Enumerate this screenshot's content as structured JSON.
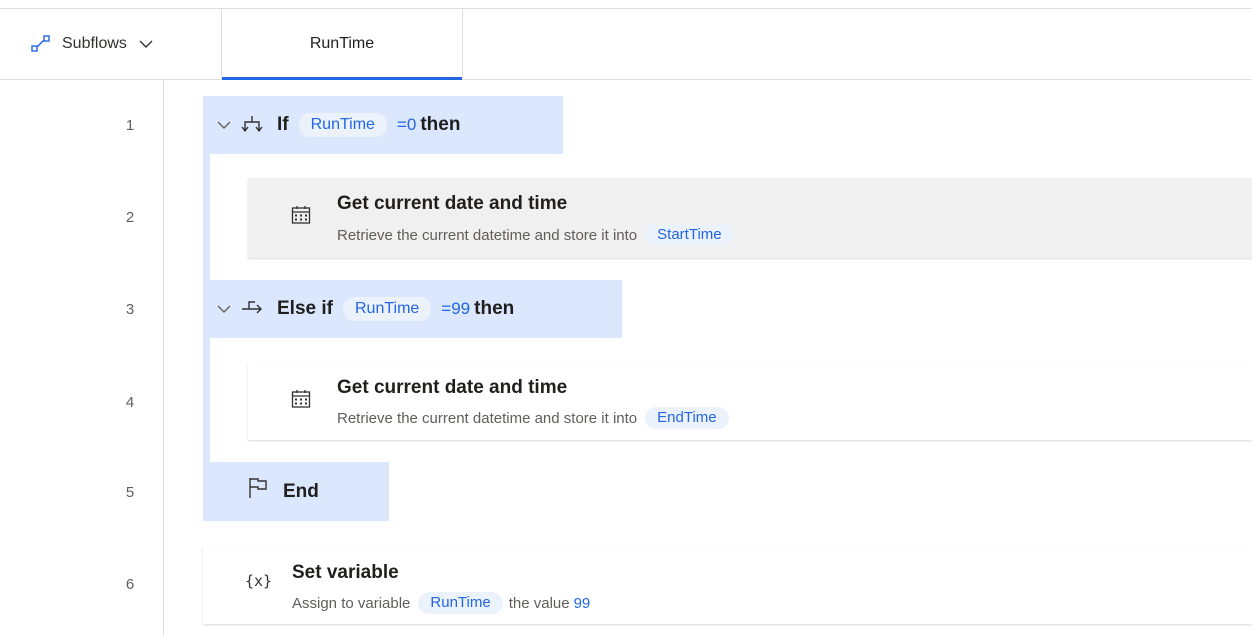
{
  "tabs": {
    "subflows_label": "Subflows",
    "active_tab": "RunTime"
  },
  "line_numbers": [
    "1",
    "2",
    "3",
    "4",
    "5",
    "6"
  ],
  "steps": {
    "if": {
      "keyword": "If",
      "variable": "RunTime",
      "operator": "=0",
      "then": "then"
    },
    "get1": {
      "title": "Get current date and time",
      "desc": "Retrieve the current datetime and store it into",
      "variable": "StartTime"
    },
    "elseif": {
      "keyword": "Else if",
      "variable": "RunTime",
      "operator": "=99",
      "then": "then"
    },
    "get2": {
      "title": "Get current date and time",
      "desc": "Retrieve the current datetime and store it into",
      "variable": "EndTime"
    },
    "end": {
      "label": "End"
    },
    "setvar": {
      "icon_text": "{x}",
      "title": "Set variable",
      "desc_prefix": "Assign to variable",
      "variable": "RunTime",
      "desc_mid": "the value",
      "value": "99"
    }
  },
  "colors": {
    "accent": "#2266e3",
    "block_bg": "#dbe7fd",
    "pill_bg": "#ecf2fc",
    "selected_bg": "#f0f0f0"
  },
  "icons": [
    "subflows-icon",
    "chevron-down-icon",
    "if-branch-icon",
    "else-if-icon",
    "calendar-icon",
    "flag-icon",
    "variable-icon"
  ]
}
